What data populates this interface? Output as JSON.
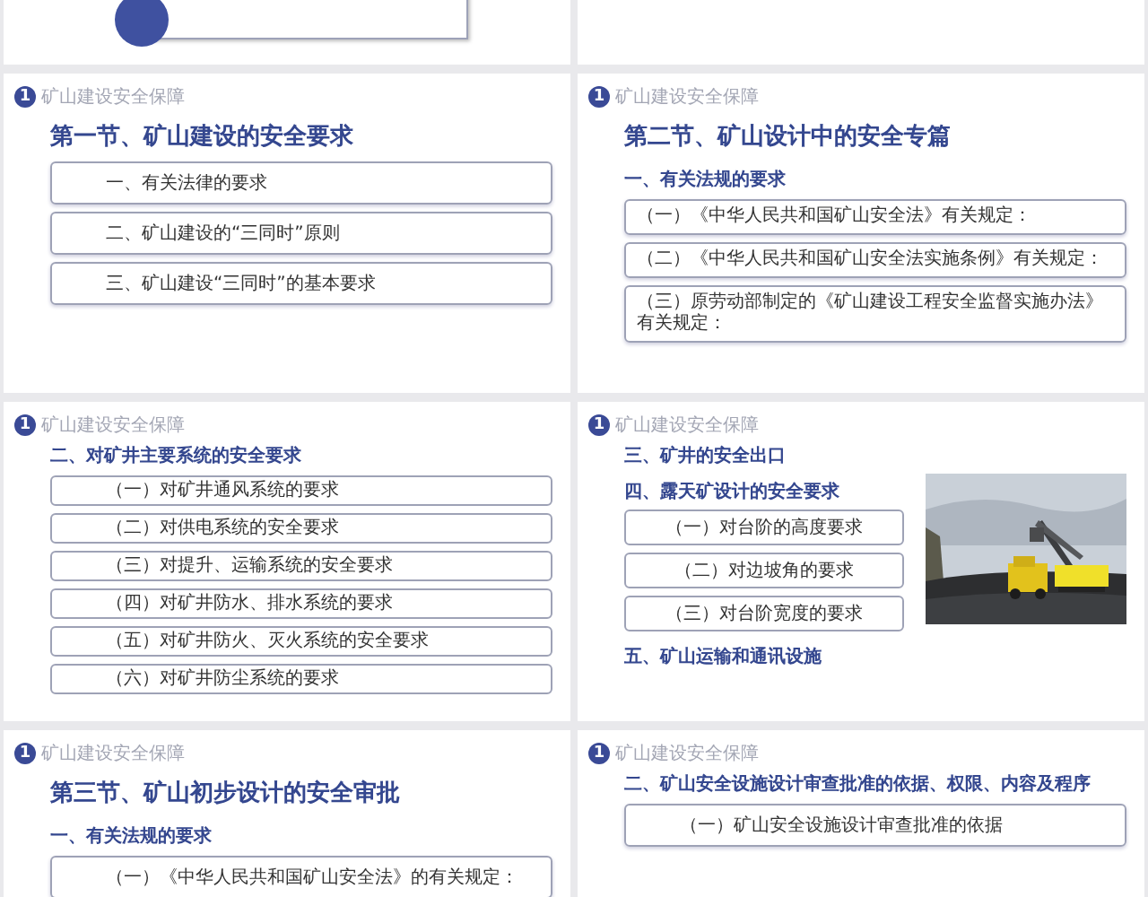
{
  "slides": [
    {
      "kind": "cut-banner"
    },
    {
      "kind": "blank"
    },
    {
      "kind": "content",
      "badge": "1",
      "section": "矿山建设安全保障",
      "blocks": [
        {
          "kind": "title",
          "text": "第一节、矿山建设的安全要求"
        },
        {
          "kind": "box",
          "text": "一、有关法律的要求"
        },
        {
          "kind": "box",
          "text": "二、矿山建设的“三同时”原则"
        },
        {
          "kind": "box",
          "text": "三、矿山建设“三同时”的基本要求"
        }
      ]
    },
    {
      "kind": "content",
      "badge": "1",
      "section": "矿山建设安全保障",
      "blocks": [
        {
          "kind": "title",
          "text": "第二节、矿山设计中的安全专篇"
        },
        {
          "kind": "heading",
          "text": "一、有关法规的要求"
        },
        {
          "kind": "wide-box",
          "text": "（一）《中华人民共和国矿山安全法》有关规定："
        },
        {
          "kind": "wide-box",
          "text": "（二）《中华人民共和国矿山安全法实施条例》有关规定："
        },
        {
          "kind": "wide-box",
          "text": "（三）原劳动部制定的《矿山建设工程安全监督实施办法》有关规定："
        }
      ]
    },
    {
      "kind": "content",
      "badge": "1",
      "section": "矿山建设安全保障",
      "blocks": [
        {
          "kind": "heading",
          "text": "二、对矿井主要系统的安全要求"
        },
        {
          "kind": "small-box",
          "text": "（一）对矿井通风系统的要求"
        },
        {
          "kind": "small-box",
          "text": "（二）对供电系统的安全要求"
        },
        {
          "kind": "small-box",
          "text": "（三）对提升、运输系统的安全要求"
        },
        {
          "kind": "small-box",
          "text": "（四）对矿井防水、排水系统的要求"
        },
        {
          "kind": "small-box",
          "text": "（五）对矿井防火、灭火系统的安全要求"
        },
        {
          "kind": "small-box",
          "text": "（六）对矿井防尘系统的要求"
        }
      ]
    },
    {
      "kind": "content",
      "badge": "1",
      "section": "矿山建设安全保障",
      "picture": {
        "kind": "picture"
      },
      "blocks": [
        {
          "kind": "heading",
          "text": "三、矿井的安全出口"
        },
        {
          "kind": "heading",
          "text": "四、露天矿设计的安全要求"
        },
        {
          "kind": "center-box",
          "text": "（一）对台阶的高度要求"
        },
        {
          "kind": "center-box",
          "text": "（二）对边坡角的要求"
        },
        {
          "kind": "center-box",
          "text": "（三）对台阶宽度的要求"
        },
        {
          "kind": "heading",
          "text": "五、矿山运输和通讯设施"
        }
      ]
    },
    {
      "kind": "content",
      "badge": "1",
      "section": "矿山建设安全保障",
      "blocks": [
        {
          "kind": "title",
          "text": "第三节、矿山初步设计的安全审批"
        },
        {
          "kind": "heading",
          "text": "一、有关法规的要求"
        },
        {
          "kind": "box",
          "text": "（一）《中华人民共和国矿山安全法》的有关规定："
        }
      ]
    },
    {
      "kind": "content",
      "badge": "1",
      "section": "矿山建设安全保障",
      "blocks": [
        {
          "kind": "heading",
          "text": "二、矿山安全设施设计审查批准的依据、权限、内容及程序"
        },
        {
          "kind": "box",
          "text": "（一）矿山安全设施设计审查批准的依据"
        }
      ]
    }
  ]
}
